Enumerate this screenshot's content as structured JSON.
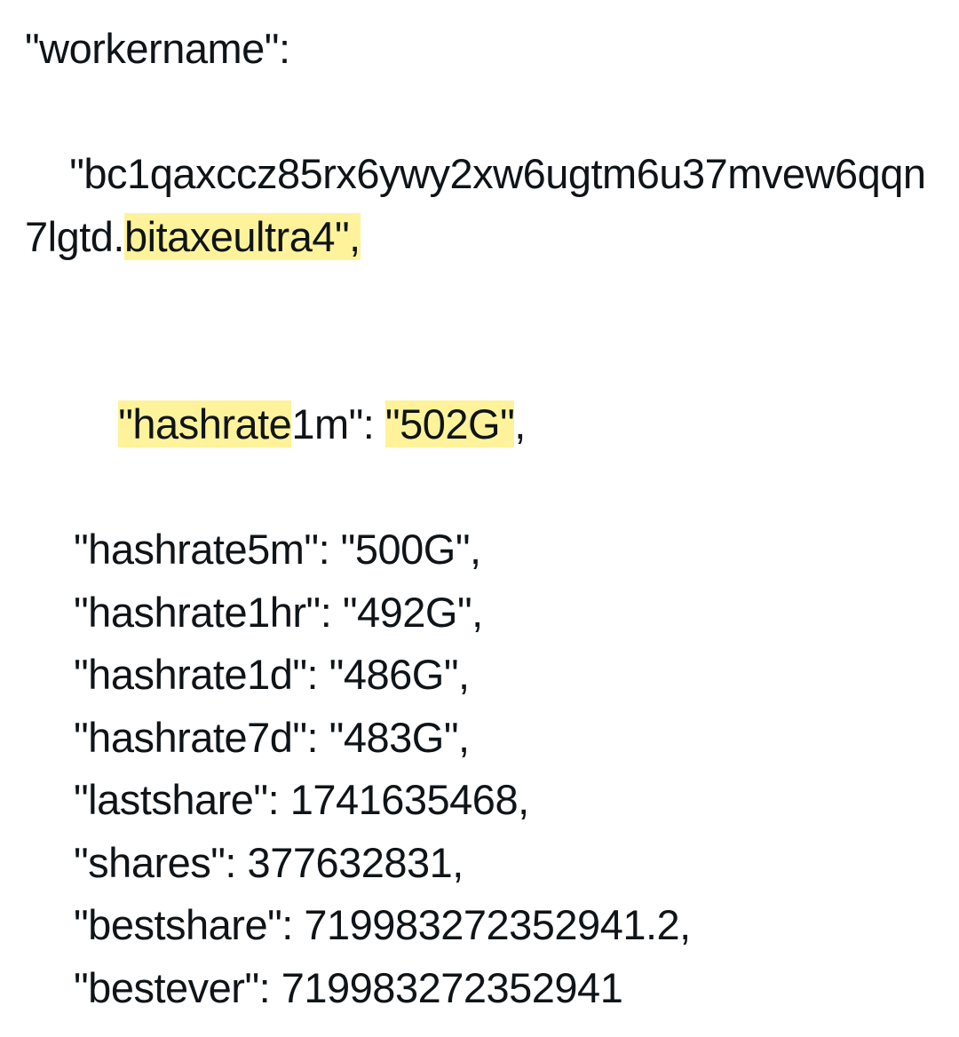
{
  "fields": {
    "workername_key": "\"workername\":",
    "workername_val_part1": "\"bc1qaxccz85rx6ywy2xw6ugtm6u37mvew6qqn7lgtd.",
    "workername_val_highlight": "bitaxeultra4\",",
    "hashrate1m_key_hl": "\"hashrate",
    "hashrate1m_key_rest": "1m\": ",
    "hashrate1m_val_hl": "\"502G\"",
    "hashrate1m_comma": ",",
    "hashrate5m": "\"hashrate5m\": \"500G\",",
    "hashrate1hr": "\"hashrate1hr\": \"492G\",",
    "hashrate1d": "\"hashrate1d\": \"486G\",",
    "hashrate7d": "\"hashrate7d\": \"483G\",",
    "lastshare": "\"lastshare\": 1741635468,",
    "shares": "\"shares\": 377632831,",
    "bestshare": "\"bestshare\": 7199832723529​41.2,",
    "bestever": "\"bestever\": 719983272352941"
  }
}
